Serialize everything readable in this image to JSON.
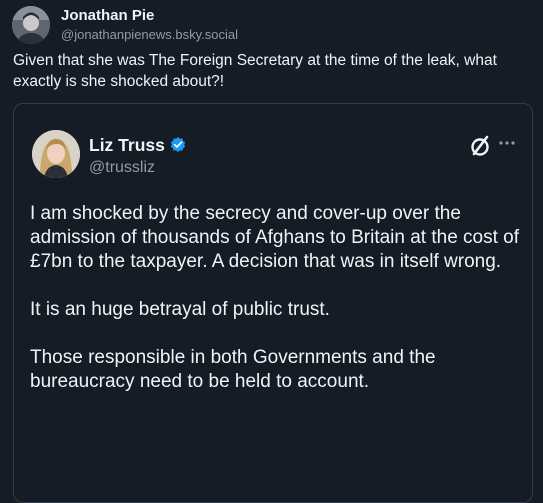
{
  "post": {
    "author": {
      "display_name": "Jonathan Pie",
      "handle": "@jonathanpienews.bsky.social",
      "avatar_icon": "user-avatar-icon"
    },
    "text": "Given that she was The Foreign Secretary at the time of the leak, what exactly is she shocked about?!"
  },
  "quoted_post": {
    "author": {
      "display_name": "Liz Truss",
      "handle": "@trussliz",
      "verified": true,
      "avatar_icon": "user-avatar-icon"
    },
    "paragraphs": [
      "I am shocked by the secrecy and cover-up over the admission of thousands of Afghans to Britain at the cost of £7bn to the taxpayer. A decision that was in itself wrong.",
      "It is an huge betrayal of public trust.",
      "Those responsible in both Governments and the bureaucracy need to be held to account."
    ],
    "icons": {
      "platform": "x-logo-icon",
      "menu": "more-options-icon"
    }
  },
  "colors": {
    "background": "#151c25",
    "text_primary": "#f1f3f5",
    "text_secondary": "#8e9baa",
    "card_border": "#2e3d4f",
    "verified_badge": "#1d9bf0"
  }
}
